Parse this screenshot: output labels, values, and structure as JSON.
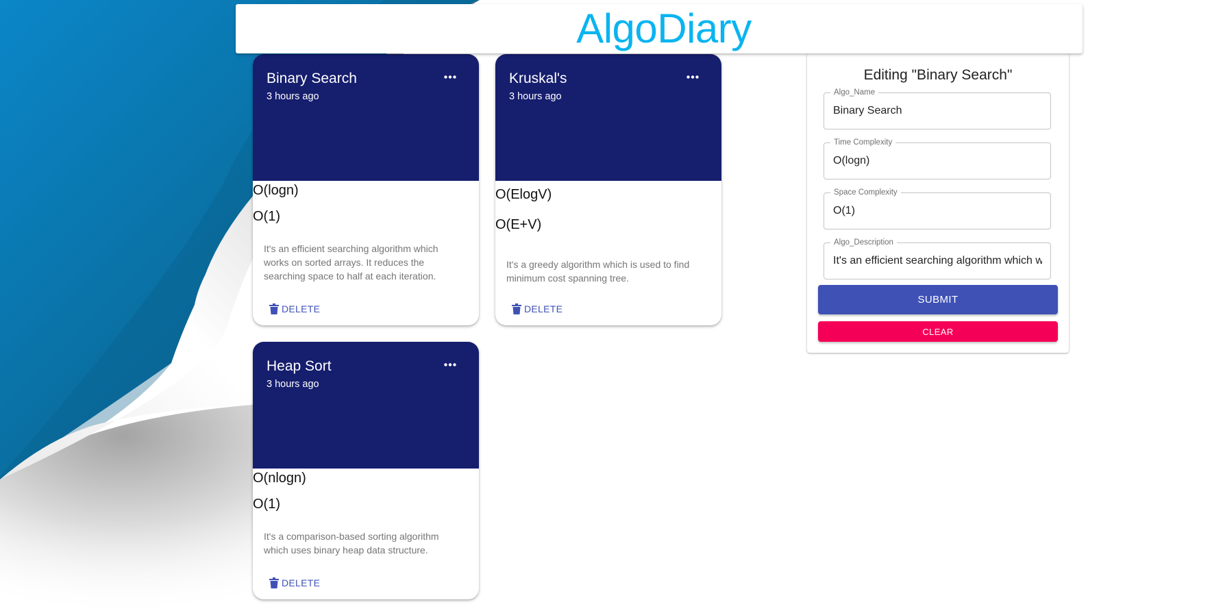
{
  "app": {
    "title": "AlgoDiary"
  },
  "cards": [
    {
      "title": "Binary Search",
      "time": "3 hours ago",
      "time_complexity": "O(logn)",
      "space_complexity": "O(1)",
      "description": "It's an efficient searching algorithm which works on sorted arrays. It reduces the searching space to half at each iteration.",
      "delete_label": "DELETE"
    },
    {
      "title": "Kruskal's",
      "time": "3 hours ago",
      "time_complexity": "O(ElogV)",
      "space_complexity": "O(E+V)",
      "description": "It's a greedy algorithm which is used to find minimum cost spanning tree.",
      "delete_label": "DELETE"
    },
    {
      "title": "Heap Sort",
      "time": "3 hours ago",
      "time_complexity": "O(nlogn)",
      "space_complexity": "O(1)",
      "description": "It's a comparison-based sorting algorithm which uses binary heap data structure.",
      "delete_label": "DELETE"
    }
  ],
  "form": {
    "heading": "Editing \"Binary Search\"",
    "fields": [
      {
        "label": "Algo_Name",
        "value": "Binary Search"
      },
      {
        "label": "Time Complexity",
        "value": "O(logn)"
      },
      {
        "label": "Space Complexity",
        "value": "O(1)"
      },
      {
        "label": "Algo_Description",
        "value": "It's an efficient searching algorithm which works on sorted arrays. It reduces the searching space to half at each iteration."
      }
    ],
    "submit_label": "SUBMIT",
    "clear_label": "CLEAR"
  },
  "icons": {
    "card_menu": "more-horiz-icon",
    "delete": "trash-icon"
  },
  "colors": {
    "brand": "#0ab4f0",
    "card_header": "#161e6e",
    "primary": "#3f51b5",
    "secondary": "#f50057"
  }
}
